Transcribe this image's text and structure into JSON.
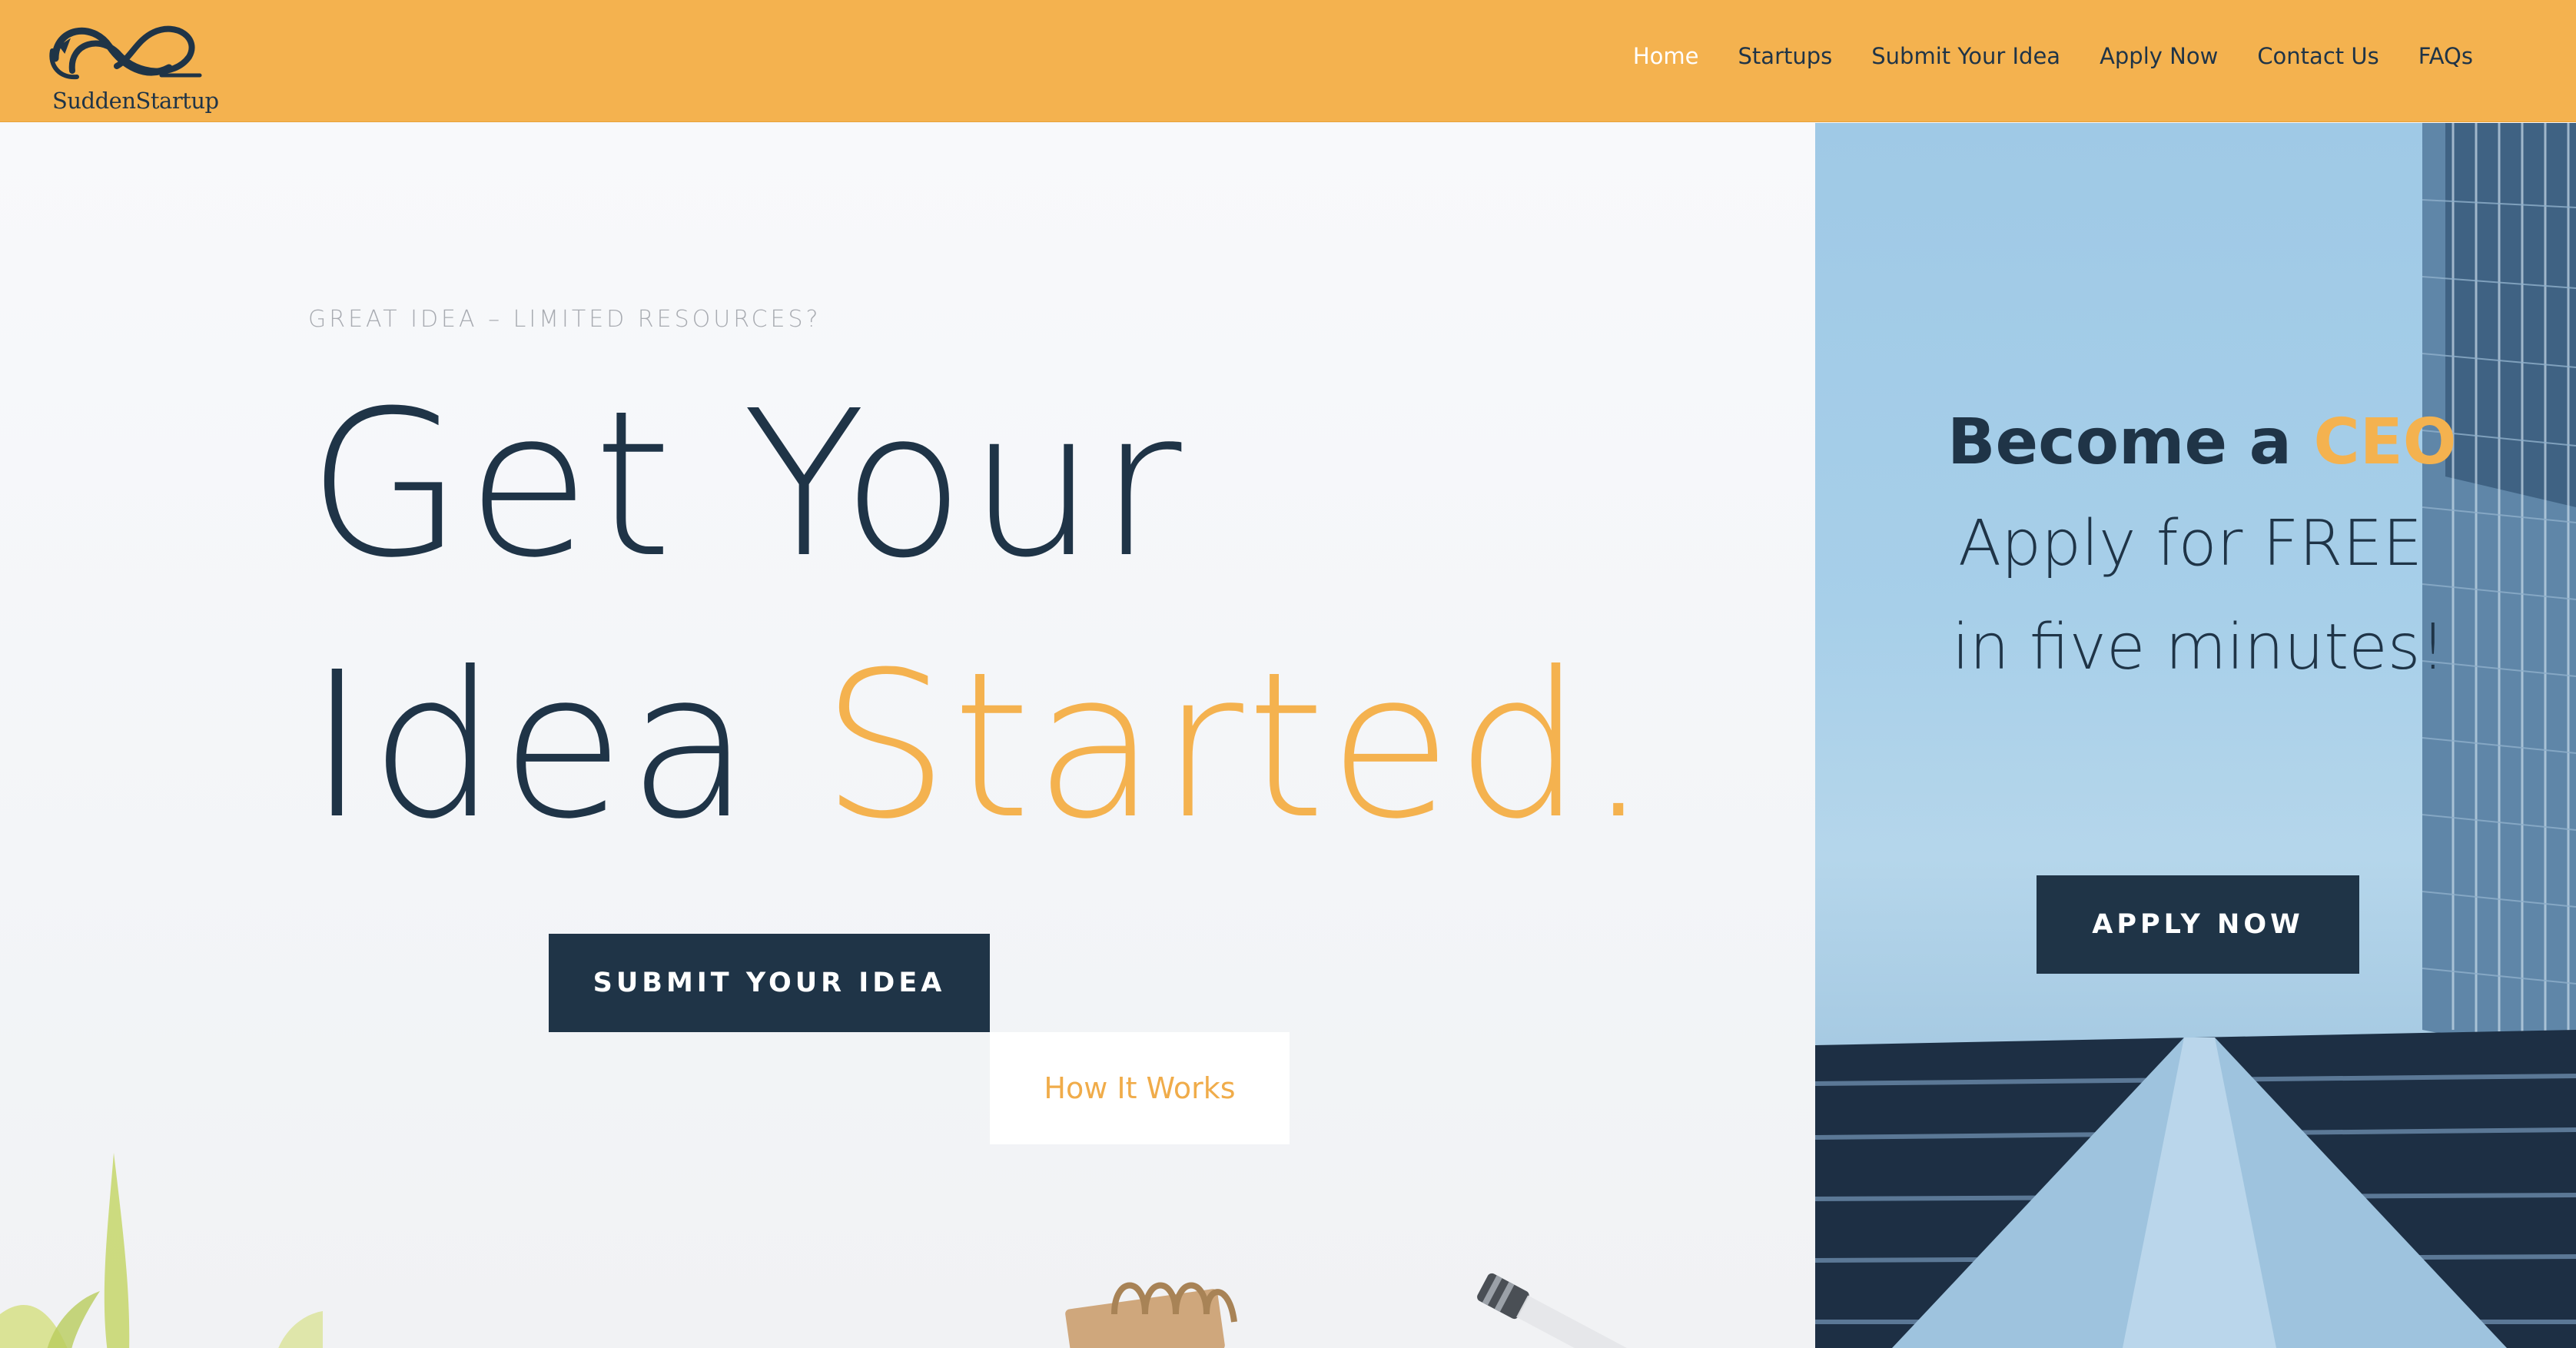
{
  "header": {
    "logo_text": "SuddenStartup",
    "background_color": "#f4b24f",
    "nav": [
      {
        "label": "Home",
        "active": true
      },
      {
        "label": "Startups"
      },
      {
        "label": "Submit Your Idea"
      },
      {
        "label": "Apply Now"
      },
      {
        "label": "Contact Us"
      },
      {
        "label": "FAQs"
      }
    ]
  },
  "hero": {
    "eyebrow": "GREAT IDEA – LIMITED RESOURCES?",
    "headline_line1": "Get Your",
    "headline_line2_prefix": "Idea ",
    "headline_line2_accent": "Started.",
    "submit_button": "SUBMIT YOUR IDEA",
    "how_button": "How It Works"
  },
  "side_panel": {
    "title_prefix": "Become a ",
    "title_accent": "CEO",
    "line1": "Apply for FREE",
    "line2": "in five minutes!",
    "apply_button": "APPLY NOW"
  },
  "colors": {
    "primary_dark": "#1f3447",
    "accent_orange": "#f4b24f",
    "sky_blue": "#a7cfe9"
  },
  "icons": {
    "logo": "sudden-startup-infinity-logo"
  }
}
